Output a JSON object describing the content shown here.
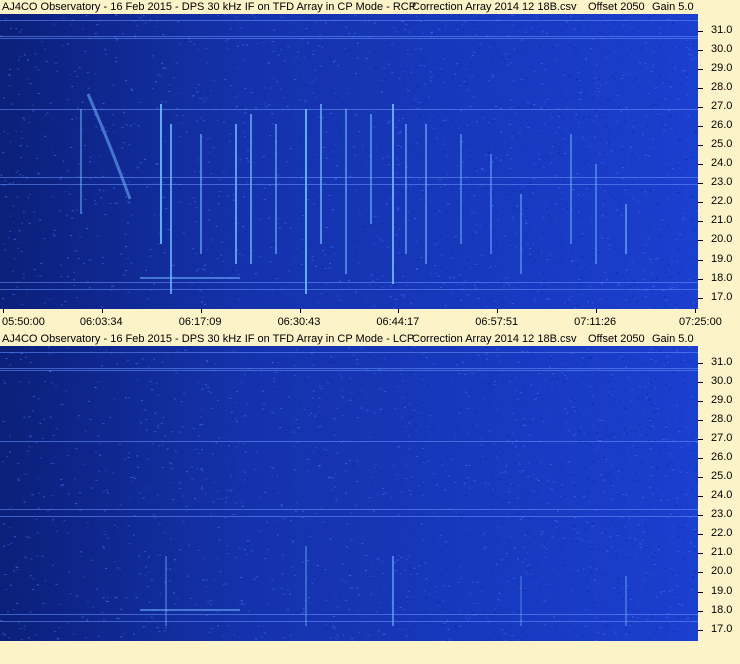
{
  "panels": [
    {
      "title_parts": {
        "observatory": "AJ4CO Observatory - 16 Feb 2015 - DPS 30 kHz IF on TFD Array in CP Mode - RCP",
        "correction": "Correction Array 2014 12 18B.csv",
        "offset": "Offset 2050",
        "gain": "Gain 5.0"
      }
    },
    {
      "title_parts": {
        "observatory": "AJ4CO Observatory - 16 Feb 2015 - DPS 30 kHz IF on TFD Array in CP Mode - LCP",
        "correction": "Correction Array 2014 12 18B.csv",
        "offset": "Offset 2050",
        "gain": "Gain 5.0"
      }
    }
  ],
  "chart_data": [
    {
      "type": "heatmap",
      "polarization": "RCP",
      "y_ticks": [
        "31.0",
        "30.0",
        "29.0",
        "28.0",
        "27.0",
        "26.0",
        "25.0",
        "24.0",
        "23.0",
        "22.0",
        "21.0",
        "20.0",
        "19.0",
        "18.0",
        "17.0"
      ],
      "ylim": [
        16.4,
        31.9
      ],
      "x_ticks": [
        "05:50:00",
        "06:03:34",
        "06:17:09",
        "06:30:43",
        "06:44:17",
        "06:57:51",
        "07:11:26",
        "07:25:00"
      ],
      "xlim": [
        "05:50:00",
        "07:25:00"
      ],
      "colors": {
        "background": "#1b3fcf",
        "bright": "#6fb6ff",
        "dark": "#081a6a"
      }
    },
    {
      "type": "heatmap",
      "polarization": "LCP",
      "y_ticks": [
        "31.0",
        "30.0",
        "29.0",
        "28.0",
        "27.0",
        "26.0",
        "25.0",
        "24.0",
        "23.0",
        "22.0",
        "21.0",
        "20.0",
        "19.0",
        "18.0",
        "17.0"
      ],
      "ylim": [
        16.4,
        31.9
      ],
      "colors": {
        "background": "#1b3fcf",
        "bright": "#6fb6ff",
        "dark": "#081a6a"
      }
    }
  ]
}
